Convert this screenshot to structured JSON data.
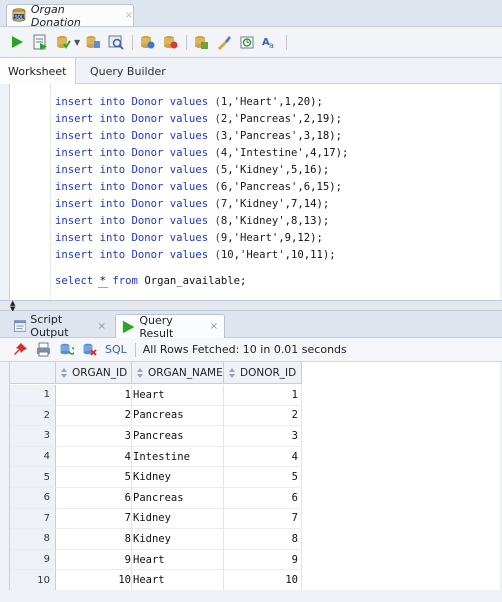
{
  "document_tab": {
    "title": "Organ Donation",
    "close": "×",
    "icon": "sql-database-icon"
  },
  "toolbar": {
    "icons": [
      "run-statement-icon",
      "run-script-icon",
      "commit-icon",
      "dropdown-arrow",
      "explain-plan-icon",
      "autotrace-icon",
      "rollback-icon",
      "sql-tuning-icon",
      "clear-icon",
      "history-icon",
      "format-icon"
    ],
    "dropdown_arrow": "▼"
  },
  "worksheet_tabs": {
    "worksheet": "Worksheet",
    "query_builder": "Query Builder"
  },
  "editor": {
    "inserts": [
      {
        "prefix": "insert into Donor values (",
        "id": "1",
        "organ": "'Heart'",
        "rest": ",1,20);"
      },
      {
        "prefix": "insert into Donor values (",
        "id": "2",
        "organ": "'Pancreas'",
        "rest": ",2,19);"
      },
      {
        "prefix": "insert into Donor values (",
        "id": "3",
        "organ": "'Pancreas'",
        "rest": ",3,18);"
      },
      {
        "prefix": "insert into Donor values (",
        "id": "4",
        "organ": "'Intestine'",
        "rest": ",4,17);"
      },
      {
        "prefix": "insert into Donor values (",
        "id": "5",
        "organ": "'Kidney'",
        "rest": ",5,16);"
      },
      {
        "prefix": "insert into Donor values (",
        "id": "6",
        "organ": "'Pancreas'",
        "rest": ",6,15);"
      },
      {
        "prefix": "insert into Donor values (",
        "id": "7",
        "organ": "'Kidney'",
        "rest": ",7,14);"
      },
      {
        "prefix": "insert into Donor values (",
        "id": "8",
        "organ": "'Kidney'",
        "rest": ",8,13);"
      },
      {
        "prefix": "insert into Donor values (",
        "id": "9",
        "organ": "'Heart'",
        "rest": ",9,12);"
      },
      {
        "prefix": "insert into Donor values (",
        "id": "10",
        "organ": "'Heart'",
        "rest": ",10,11);"
      }
    ],
    "select_line": {
      "select": "select ",
      "star": "*",
      "from": " from ",
      "table": "Organ_available;"
    }
  },
  "result_tabs": {
    "script_output": "Script Output",
    "query_result": "Query Result",
    "close": "×"
  },
  "result_toolbar": {
    "sql_label": "SQL",
    "status": "All Rows Fetched: 10 in 0.01 seconds",
    "icons": [
      "pin-icon",
      "print-icon",
      "refresh-icon",
      "export-icon"
    ]
  },
  "grid": {
    "columns": [
      "ORGAN_ID",
      "ORGAN_NAME",
      "DONOR_ID"
    ],
    "rows": [
      {
        "rn": "1",
        "organ_id": "1",
        "organ_name": "Heart",
        "donor_id": "1"
      },
      {
        "rn": "2",
        "organ_id": "2",
        "organ_name": "Pancreas",
        "donor_id": "2"
      },
      {
        "rn": "3",
        "organ_id": "3",
        "organ_name": "Pancreas",
        "donor_id": "3"
      },
      {
        "rn": "4",
        "organ_id": "4",
        "organ_name": "Intestine",
        "donor_id": "4"
      },
      {
        "rn": "5",
        "organ_id": "5",
        "organ_name": "Kidney",
        "donor_id": "5"
      },
      {
        "rn": "6",
        "organ_id": "6",
        "organ_name": "Pancreas",
        "donor_id": "6"
      },
      {
        "rn": "7",
        "organ_id": "7",
        "organ_name": "Kidney",
        "donor_id": "7"
      },
      {
        "rn": "8",
        "organ_id": "8",
        "organ_name": "Kidney",
        "donor_id": "8"
      },
      {
        "rn": "9",
        "organ_id": "9",
        "organ_name": "Heart",
        "donor_id": "9"
      },
      {
        "rn": "10",
        "organ_id": "10",
        "organ_name": "Heart",
        "donor_id": "10"
      }
    ]
  },
  "colors": {
    "keyword": "#1d39c4",
    "sql_link": "#3a62b0",
    "run_green": "#2aa52a"
  }
}
